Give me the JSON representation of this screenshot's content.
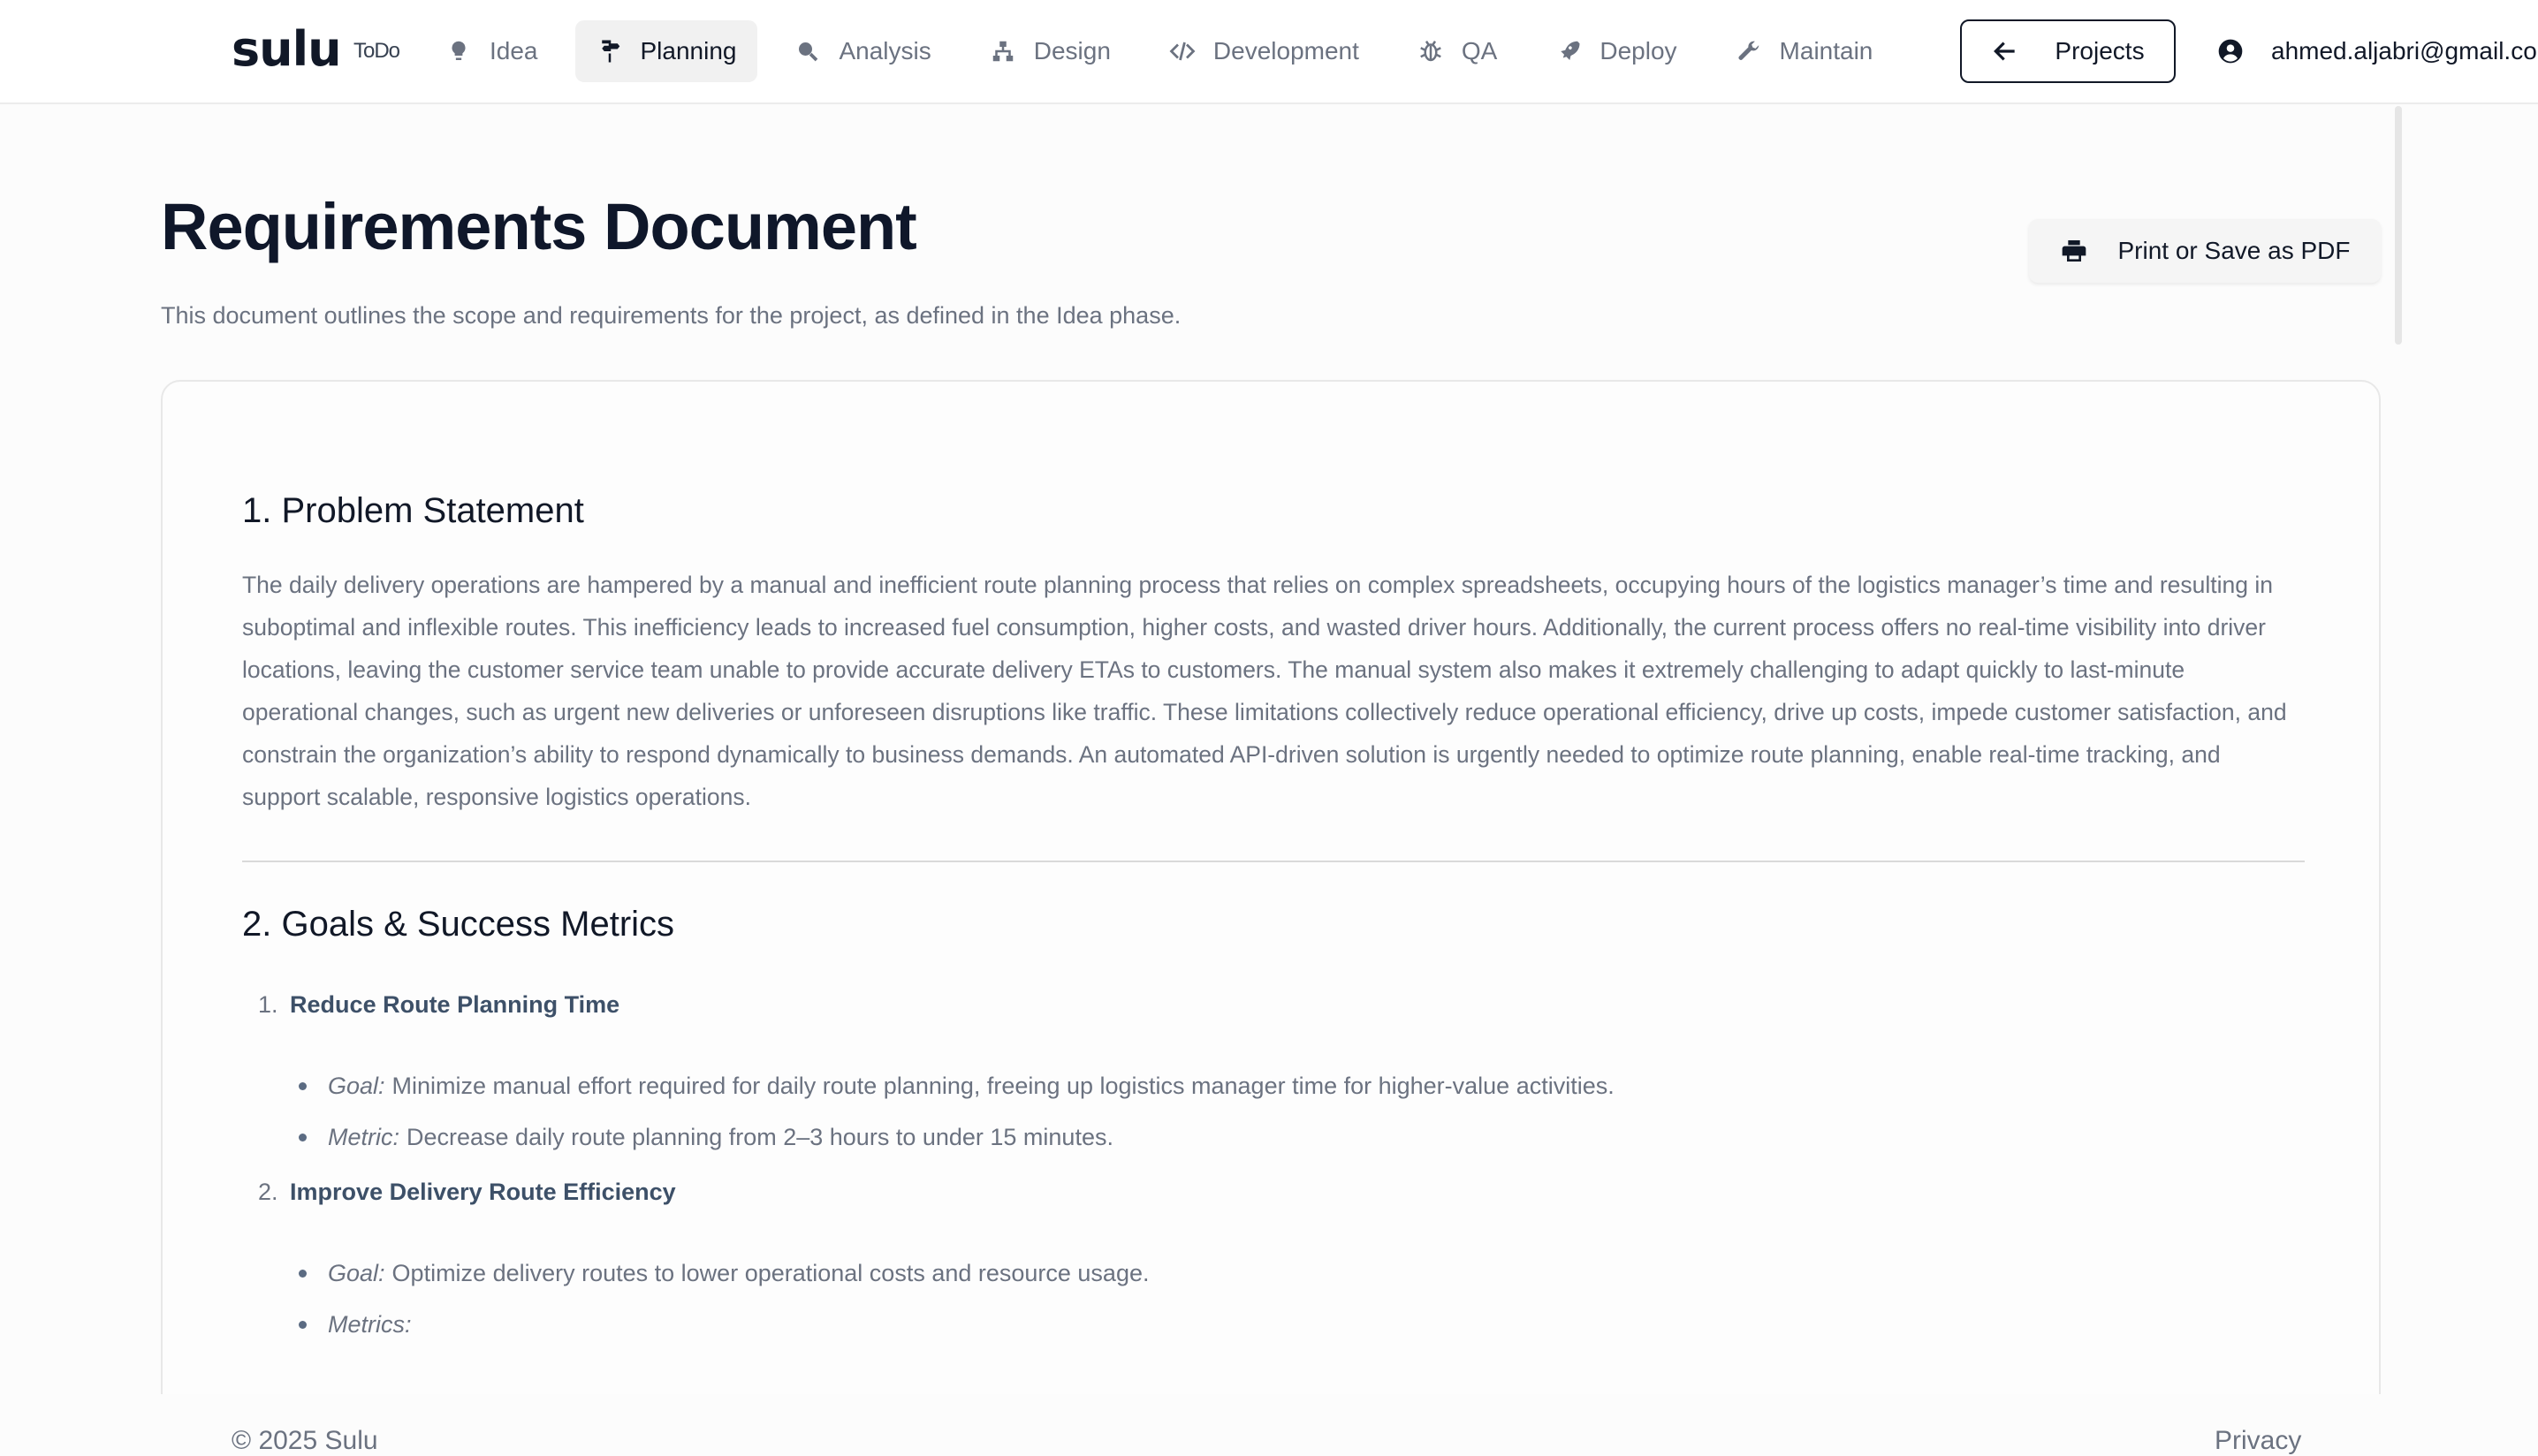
{
  "brand": {
    "logo": "sulu",
    "tag": "ToDo"
  },
  "nav": [
    {
      "label": "Idea",
      "icon": "lightbulb-icon"
    },
    {
      "label": "Planning",
      "icon": "signpost-icon",
      "active": true
    },
    {
      "label": "Analysis",
      "icon": "magnifier-icon"
    },
    {
      "label": "Design",
      "icon": "sitemap-icon"
    },
    {
      "label": "Development",
      "icon": "code-icon"
    },
    {
      "label": "QA",
      "icon": "bug-icon"
    },
    {
      "label": "Deploy",
      "icon": "rocket-icon"
    },
    {
      "label": "Maintain",
      "icon": "wrench-icon"
    }
  ],
  "projects_button": {
    "label": "Projects",
    "icon": "arrow-left-icon"
  },
  "user": {
    "email": "ahmed.aljabri@gmail.com",
    "icon": "user-circle-icon"
  },
  "page": {
    "title": "Requirements Document",
    "subtitle": "This document outlines the scope and requirements for the project, as defined in the Idea phase.",
    "print_button": "Print or Save as PDF"
  },
  "document": {
    "problem": {
      "heading": "1. Problem Statement",
      "text": "The daily delivery operations are hampered by a manual and inefficient route planning process that relies on complex spreadsheets, occupying hours of the logistics manager’s time and resulting in suboptimal and inflexible routes. This inefficiency leads to increased fuel consumption, higher costs, and wasted driver hours. Additionally, the current process offers no real-time visibility into driver locations, leaving the customer service team unable to provide accurate delivery ETAs to customers. The manual system also makes it extremely challenging to adapt quickly to last-minute operational changes, such as urgent new deliveries or unforeseen disruptions like traffic. These limitations collectively reduce operational efficiency, drive up costs, impede customer satisfaction, and constrain the organization’s ability to respond dynamically to business demands. An automated API-driven solution is urgently needed to optimize route planning, enable real-time tracking, and support scalable, responsive logistics operations."
    },
    "goals": {
      "heading": "2. Goals & Success Metrics",
      "items": [
        {
          "num": "1.",
          "title": "Reduce Route Planning Time",
          "goal_label": "Goal:",
          "goal": "Minimize manual effort required for daily route planning, freeing up logistics manager time for higher-value activities.",
          "metric_label": "Metric:",
          "metric": "Decrease daily route planning from 2–3 hours to under 15 minutes."
        },
        {
          "num": "2.",
          "title": "Improve Delivery Route Efficiency",
          "goal_label": "Goal:",
          "goal": "Optimize delivery routes to lower operational costs and resource usage.",
          "metric_label": "Metrics:",
          "metric": ""
        }
      ]
    }
  },
  "footer": {
    "copyright": "© 2025 Sulu",
    "privacy": "Privacy"
  }
}
